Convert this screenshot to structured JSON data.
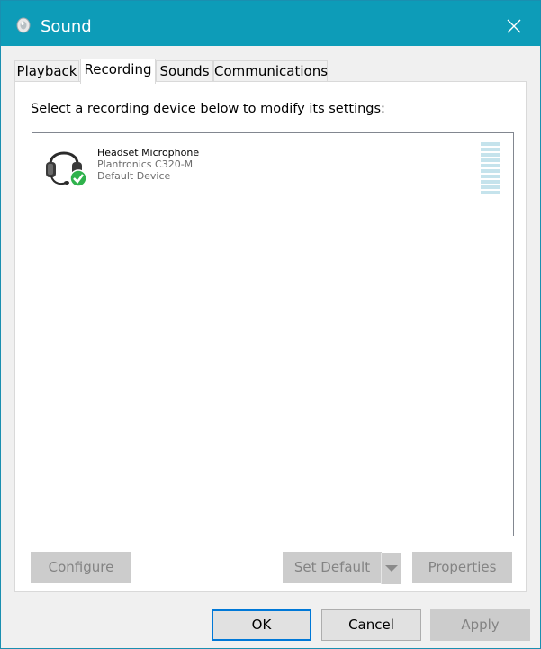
{
  "window": {
    "title": "Sound",
    "close_icon": "close-icon",
    "title_icon": "speaker-icon"
  },
  "tabs": [
    {
      "label": "Playback",
      "active": false
    },
    {
      "label": "Recording",
      "active": true
    },
    {
      "label": "Sounds",
      "active": false
    },
    {
      "label": "Communications",
      "active": false
    }
  ],
  "panel": {
    "instruction": "Select a recording device below to modify its settings:",
    "devices": [
      {
        "name": "Headset Microphone",
        "model": "Plantronics C320-M",
        "status": "Default Device",
        "icon": "headset-icon",
        "badge": "default-check-icon"
      }
    ],
    "buttons": {
      "configure": "Configure",
      "set_default": "Set Default",
      "properties": "Properties"
    }
  },
  "footer": {
    "ok": "OK",
    "cancel": "Cancel",
    "apply": "Apply"
  },
  "colors": {
    "titlebar": "#0d9cb8",
    "focus_border": "#0078d7",
    "check_badge": "#2fb24c"
  }
}
